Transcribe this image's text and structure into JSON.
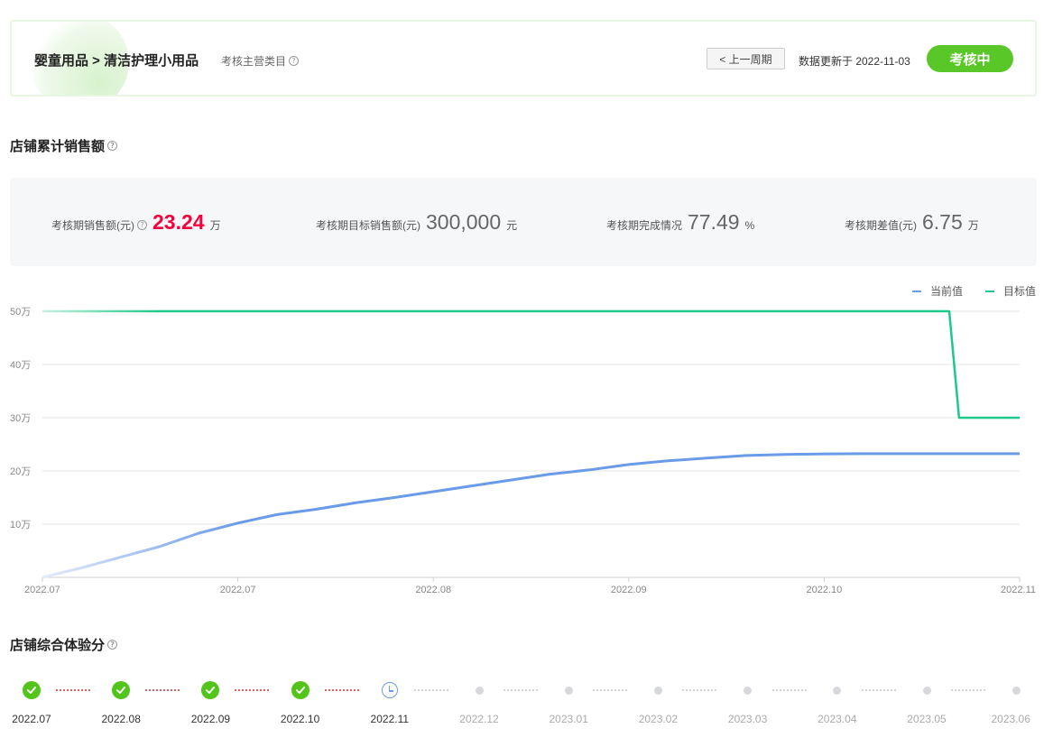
{
  "header": {
    "category_path": "婴童用品 > 清洁护理小用品",
    "category_note": "考核主营类目",
    "prev_label": "< 上一周期",
    "update_text": "数据更新于 2022-11-03",
    "status_label": "考核中"
  },
  "sales_section": {
    "title": "店铺累计销售额"
  },
  "stats": [
    {
      "label": "考核期销售额(元)",
      "value": "23.24",
      "unit": "万",
      "has_help": true
    },
    {
      "label": "考核期目标销售额(元)",
      "value": "300,000",
      "unit": "元",
      "has_help": false
    },
    {
      "label": "考核期完成情况",
      "value": "77.49",
      "unit": "%",
      "has_help": false
    },
    {
      "label": "考核期差值(元)",
      "value": "6.75",
      "unit": "万",
      "has_help": false
    }
  ],
  "chart_data": {
    "type": "line",
    "yticks": [
      "10万",
      "20万",
      "30万",
      "40万",
      "50万"
    ],
    "ytick_values": [
      10,
      20,
      30,
      40,
      50
    ],
    "ylim": [
      0,
      50
    ],
    "xticks": [
      "2022.07",
      "2022.07",
      "2022.08",
      "2022.09",
      "2022.10",
      "2022.11"
    ],
    "xtick_values": [
      0,
      10,
      20,
      30,
      40,
      50
    ],
    "xlim": [
      0,
      50
    ],
    "grid": true,
    "legend_position": "top-right",
    "series": [
      {
        "name": "当前值",
        "color": "#6a9be8",
        "x": [
          0,
          2,
          4,
          6,
          8,
          10,
          12,
          14,
          16,
          18,
          20,
          22,
          24,
          26,
          28,
          30,
          32,
          34,
          36,
          38,
          40,
          42,
          44,
          46,
          48,
          50
        ],
        "y": [
          0,
          1.8,
          3.8,
          5.8,
          8.3,
          10.2,
          11.8,
          12.8,
          14.0,
          15.0,
          16.1,
          17.2,
          18.3,
          19.4,
          20.2,
          21.2,
          21.9,
          22.4,
          22.9,
          23.1,
          23.2,
          23.24,
          23.24,
          23.24,
          23.24,
          23.24
        ]
      },
      {
        "name": "目标值",
        "color": "#1cc88a",
        "x": [
          0,
          46.4,
          46.9,
          50
        ],
        "y": [
          50,
          50,
          30,
          30
        ]
      }
    ]
  },
  "experience_section": {
    "title": "店铺综合体验分"
  },
  "timeline": [
    {
      "label": "2022.07",
      "state": "done"
    },
    {
      "label": "2022.08",
      "state": "done"
    },
    {
      "label": "2022.09",
      "state": "done"
    },
    {
      "label": "2022.10",
      "state": "done"
    },
    {
      "label": "2022.11",
      "state": "current"
    },
    {
      "label": "2022.12",
      "state": "future"
    },
    {
      "label": "2023.01",
      "state": "future"
    },
    {
      "label": "2023.02",
      "state": "future"
    },
    {
      "label": "2023.03",
      "state": "future"
    },
    {
      "label": "2023.04",
      "state": "future"
    },
    {
      "label": "2023.05",
      "state": "future"
    },
    {
      "label": "2023.06",
      "state": "future"
    }
  ]
}
